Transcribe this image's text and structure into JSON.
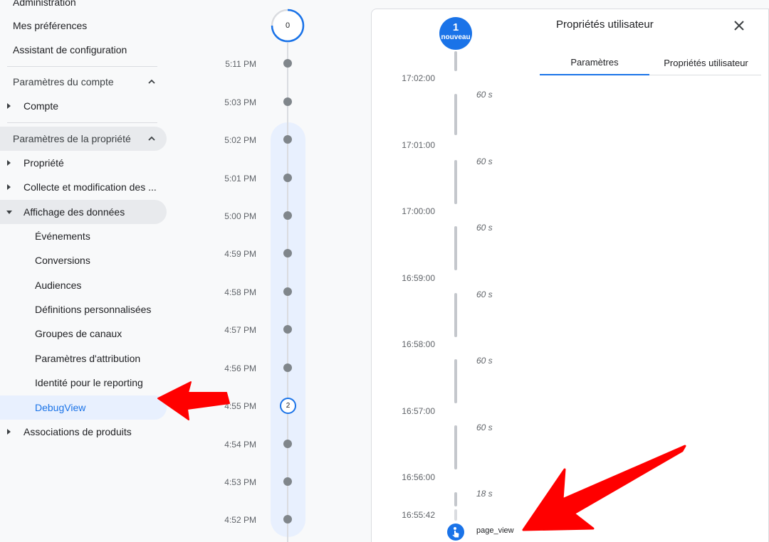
{
  "sidebar": {
    "top_items": [
      {
        "label": "Administration"
      },
      {
        "label": "Mes préférences"
      },
      {
        "label": "Assistant de configuration"
      }
    ],
    "account_section": {
      "label": "Paramètres du compte",
      "items": [
        {
          "label": "Compte"
        }
      ]
    },
    "property_section": {
      "label": "Paramètres de la propriété",
      "items": [
        {
          "label": "Propriété"
        },
        {
          "label": "Collecte et modification des ..."
        },
        {
          "label": "Affichage des données"
        }
      ],
      "data_display_children": [
        {
          "label": "Événements"
        },
        {
          "label": "Conversions"
        },
        {
          "label": "Audiences"
        },
        {
          "label": "Définitions personnalisées"
        },
        {
          "label": "Groupes de canaux"
        },
        {
          "label": "Paramètres d'attribution"
        },
        {
          "label": "Identité pour le reporting"
        },
        {
          "label": "DebugView"
        }
      ],
      "after_items": [
        {
          "label": "Associations de produits"
        }
      ]
    }
  },
  "minutes_timeline": {
    "top_count": "0",
    "selected_count": "2",
    "labels": [
      "5:11 PM",
      "5:03 PM",
      "5:02 PM",
      "5:01 PM",
      "5:00 PM",
      "4:59 PM",
      "4:58 PM",
      "4:57 PM",
      "4:56 PM",
      "4:55 PM",
      "4:54 PM",
      "4:53 PM",
      "4:52 PM"
    ]
  },
  "seconds_stream": {
    "badge_number": "1",
    "badge_label": "nouveau",
    "times": [
      "17:02:00",
      "17:01:00",
      "17:00:00",
      "16:59:00",
      "16:58:00",
      "16:57:00",
      "16:56:00",
      "16:55:42"
    ],
    "gaps": [
      "60 s",
      "60 s",
      "60 s",
      "60 s",
      "60 s",
      "60 s",
      "18 s"
    ],
    "event": {
      "name": "page_view",
      "icon": "touch-icon"
    }
  },
  "drawer": {
    "title": "Propriétés utilisateur",
    "tabs": [
      {
        "label": "Paramètres",
        "active": true
      },
      {
        "label": "Propriétés utilisateur",
        "active": false
      }
    ]
  },
  "colors": {
    "accent": "#1a73e8",
    "annotation": "#ff0000",
    "selected_bg": "#e8f0fe"
  }
}
